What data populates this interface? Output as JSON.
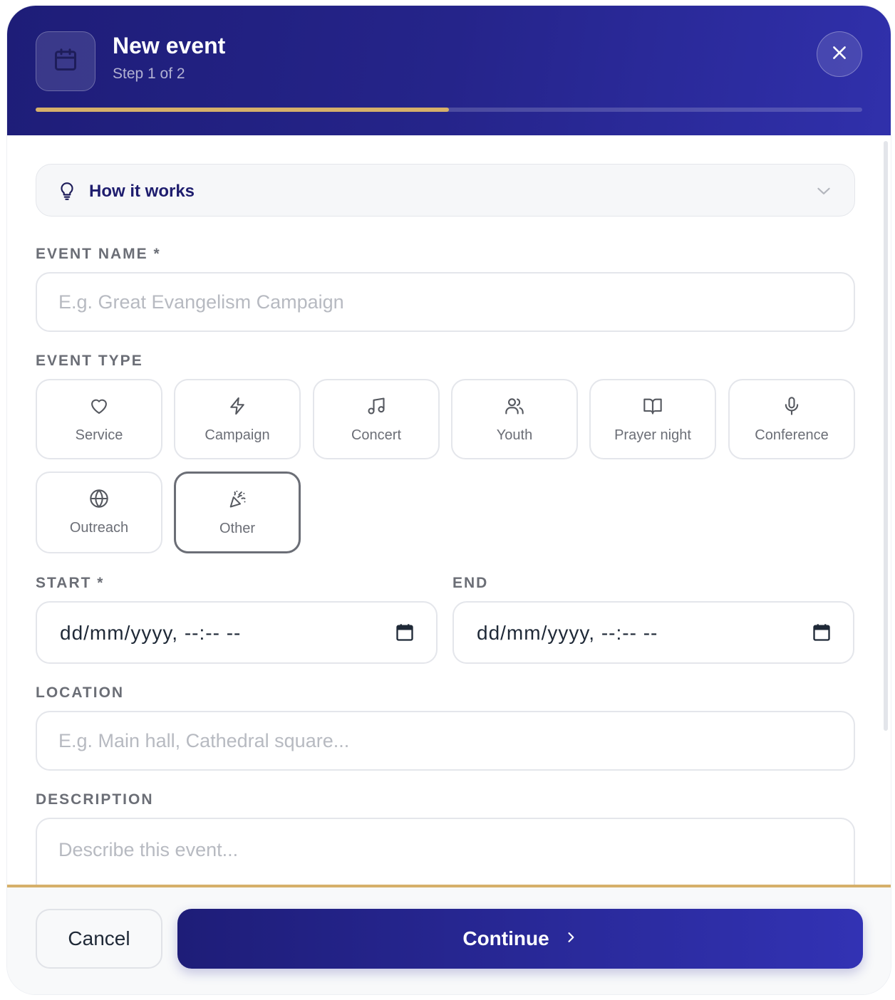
{
  "header": {
    "title": "New event",
    "step": "Step 1 of 2",
    "progress_percent": 50,
    "icon": "calendar-icon",
    "close_icon": "close-icon"
  },
  "how_it_works": {
    "label": "How it works",
    "icon": "lightbulb-icon",
    "expand_icon": "chevron-down-icon"
  },
  "event_name": {
    "label": "EVENT NAME *",
    "placeholder": "E.g. Great Evangelism Campaign",
    "value": ""
  },
  "event_type": {
    "label": "EVENT TYPE",
    "selected": "Other",
    "options": [
      {
        "label": "Service",
        "icon": "heart-icon"
      },
      {
        "label": "Campaign",
        "icon": "lightning-icon"
      },
      {
        "label": "Concert",
        "icon": "music-note-icon"
      },
      {
        "label": "Youth",
        "icon": "users-icon"
      },
      {
        "label": "Prayer night",
        "icon": "open-book-icon"
      },
      {
        "label": "Conference",
        "icon": "microphone-icon"
      },
      {
        "label": "Outreach",
        "icon": "globe-icon"
      },
      {
        "label": "Other",
        "icon": "party-popper-icon"
      }
    ]
  },
  "start": {
    "label": "START *",
    "value": "dd/mm/yyyy, --:-- --",
    "icon": "calendar-icon"
  },
  "end": {
    "label": "END",
    "value": "dd/mm/yyyy, --:-- --",
    "icon": "calendar-icon"
  },
  "location": {
    "label": "LOCATION",
    "placeholder": "E.g. Main hall, Cathedral square...",
    "value": ""
  },
  "description": {
    "label": "DESCRIPTION",
    "placeholder": "Describe this event...",
    "value": ""
  },
  "footer": {
    "cancel_label": "Cancel",
    "continue_label": "Continue",
    "continue_icon": "chevron-right-icon"
  },
  "colors": {
    "header_start": "#1e1d78",
    "header_end": "#3030ab",
    "accent_gold": "#d6b06a",
    "label_gray": "#6b6e76"
  }
}
